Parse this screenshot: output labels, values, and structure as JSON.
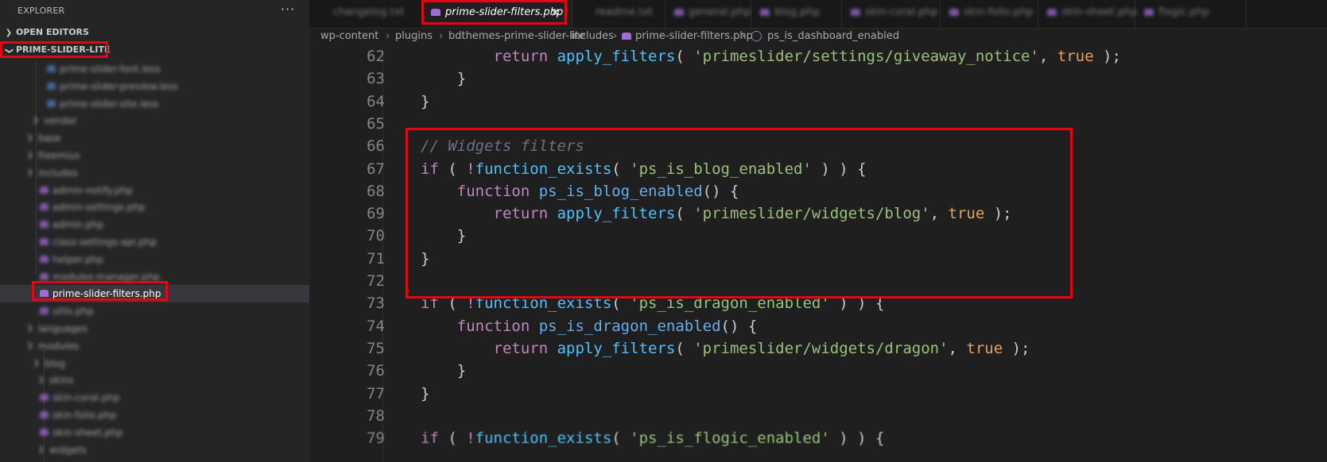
{
  "sidebar": {
    "title": "EXPLORER",
    "more_label": "···",
    "open_editors": "OPEN EDITORS",
    "project": "PRIME-SLIDER-LITE",
    "tree": [
      {
        "label": "prime-slider-font.less",
        "blurred": true
      },
      {
        "label": "prime-slider-preview.less",
        "blurred": true
      },
      {
        "label": "prime-slider-site.less",
        "blurred": true
      },
      {
        "label": "vendor",
        "blurred": true
      },
      {
        "label": "base",
        "blurred": true
      },
      {
        "label": "freemius",
        "blurred": true
      },
      {
        "label": "includes",
        "blurred": true
      },
      {
        "label": "admin-notify.php",
        "blurred": true
      },
      {
        "label": "admin-settings.php",
        "blurred": true
      },
      {
        "label": "admin.php",
        "blurred": true
      },
      {
        "label": "class-settings-api.php",
        "blurred": true
      },
      {
        "label": "helper.php",
        "blurred": true
      },
      {
        "label": "modules-manager.php",
        "blurred": true
      },
      {
        "label": "prime-slider-filters.php",
        "blurred": false
      },
      {
        "label": "utils.php",
        "blurred": true
      },
      {
        "label": "languages",
        "blurred": true
      },
      {
        "label": "modules",
        "blurred": true
      },
      {
        "label": "blog",
        "blurred": true
      },
      {
        "label": "skins",
        "blurred": true
      },
      {
        "label": "skin-coral.php",
        "blurred": true
      },
      {
        "label": "skin-folio.php",
        "blurred": true
      },
      {
        "label": "skin-sheet.php",
        "blurred": true
      },
      {
        "label": "widgets",
        "blurred": true
      }
    ]
  },
  "tabs": [
    {
      "label": "changelog.txt",
      "active": false
    },
    {
      "label": "prime-slider-filters.php",
      "active": true,
      "close": "✕"
    },
    {
      "label": "readme.txt",
      "active": false
    },
    {
      "label": "general.php",
      "active": false
    },
    {
      "label": "blog.php",
      "active": false
    },
    {
      "label": "skin-coral.php",
      "active": false
    },
    {
      "label": "skin-folio.php",
      "active": false
    },
    {
      "label": "skin-sheet.php",
      "active": false
    },
    {
      "label": "flogic.php",
      "active": false
    }
  ],
  "breadcrumb": [
    "wp-content",
    "plugins",
    "bdthemes-prime-slider-lite",
    "includes",
    "prime-slider-filters.php",
    "ps_is_dashboard_enabled"
  ],
  "editor": {
    "lines": [
      {
        "n": "62",
        "text": "        return apply_filters( 'primeslider/settings/giveaway_notice', true );"
      },
      {
        "n": "63",
        "text": "    }"
      },
      {
        "n": "64",
        "text": "}"
      },
      {
        "n": "65",
        "text": ""
      },
      {
        "n": "66",
        "text": "// Widgets filters"
      },
      {
        "n": "67",
        "text": "if ( !function_exists( 'ps_is_blog_enabled' ) ) {"
      },
      {
        "n": "68",
        "text": "    function ps_is_blog_enabled() {"
      },
      {
        "n": "69",
        "text": "        return apply_filters( 'primeslider/widgets/blog', true );"
      },
      {
        "n": "70",
        "text": "    }"
      },
      {
        "n": "71",
        "text": "}"
      },
      {
        "n": "72",
        "text": ""
      },
      {
        "n": "73",
        "text": "if ( !function_exists( 'ps_is_dragon_enabled' ) ) {"
      },
      {
        "n": "74",
        "text": "    function ps_is_dragon_enabled() {"
      },
      {
        "n": "75",
        "text": "        return apply_filters( 'primeslider/widgets/dragon', true );"
      },
      {
        "n": "76",
        "text": "    }"
      },
      {
        "n": "77",
        "text": "}"
      },
      {
        "n": "78",
        "text": ""
      },
      {
        "n": "79",
        "text": "if ( !function_exists( 'ps_is_flogic_enabled' ) ) {"
      }
    ]
  },
  "colors": {
    "highlight_box": "#e30613",
    "keyword": "#c586c0",
    "function": "#4fc1ff",
    "string": "#98c379",
    "boolean": "#e5a15c",
    "comment": "#6a7380"
  }
}
